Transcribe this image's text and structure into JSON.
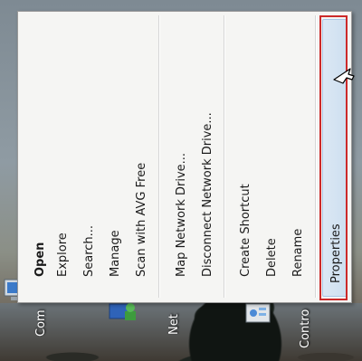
{
  "menu": {
    "items": [
      {
        "label": "Open",
        "bold": true
      },
      {
        "label": "Explore"
      },
      {
        "label": "Search..."
      },
      {
        "label": "Manage"
      },
      {
        "label": "Scan with AVG Free"
      },
      {
        "label": "Map Network Drive..."
      },
      {
        "label": "Disconnect Network Drive..."
      },
      {
        "label": "Create Shortcut"
      },
      {
        "label": "Delete"
      },
      {
        "label": "Rename"
      },
      {
        "label": "Properties",
        "highlighted": true
      }
    ]
  },
  "desktop": {
    "icons": [
      {
        "label": "Com",
        "icon": "computer-icon"
      },
      {
        "label": "Net",
        "icon": "network-icon"
      },
      {
        "label": "Contro",
        "icon": "control-panel-icon"
      }
    ]
  },
  "colors": {
    "highlight_border": "#cc2a2a",
    "selected_item_bg": "#dce8f4",
    "menu_bg": "#f5f5f3"
  }
}
